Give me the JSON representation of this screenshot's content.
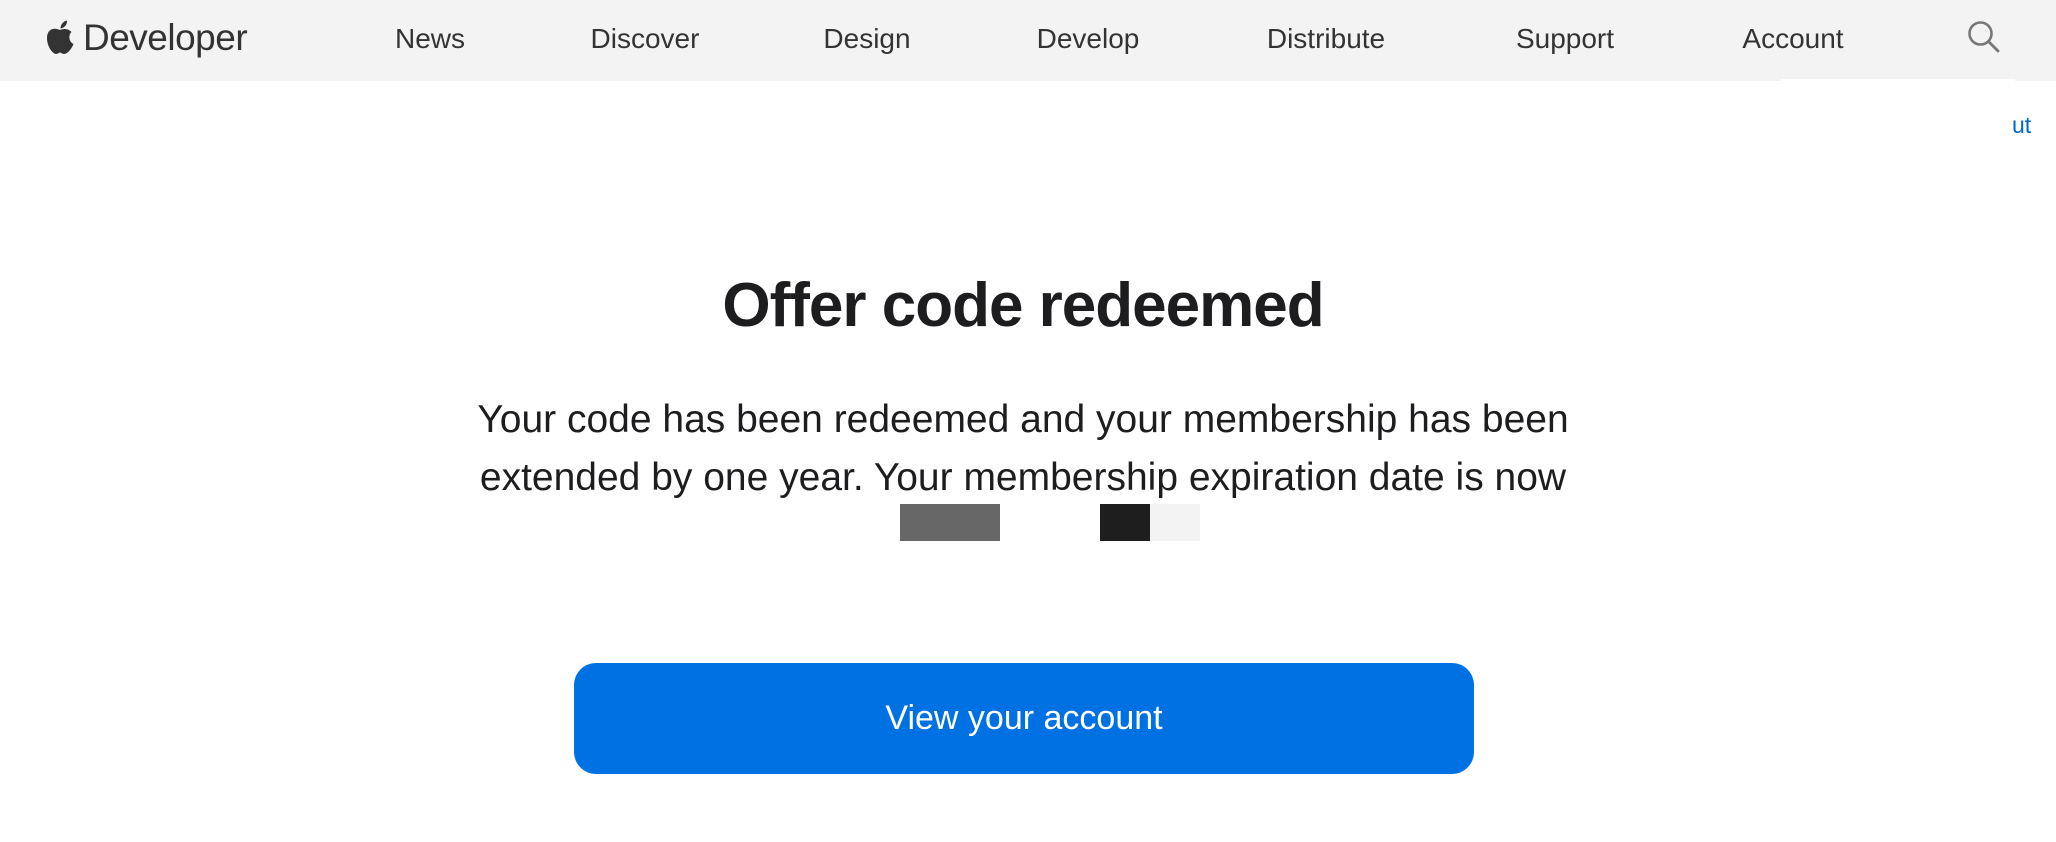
{
  "nav": {
    "brand_label": "Developer",
    "items": [
      {
        "label": "News"
      },
      {
        "label": "Discover"
      },
      {
        "label": "Design"
      },
      {
        "label": "Develop"
      },
      {
        "label": "Distribute"
      },
      {
        "label": "Support"
      },
      {
        "label": "Account"
      }
    ],
    "icons": {
      "brand": "apple-logo",
      "search": "search-icon"
    },
    "clipped_link_fragment": "ut"
  },
  "main": {
    "title": "Offer code redeemed",
    "message": "Your code has been redeemed and your membership has been extended by one year. Your membership expiration date is now",
    "cta_label": "View your account"
  },
  "colors": {
    "nav_background": "#f3f3f3",
    "accent_button": "#0071e3",
    "link": "#0066cc",
    "text": "#1d1d1f"
  }
}
